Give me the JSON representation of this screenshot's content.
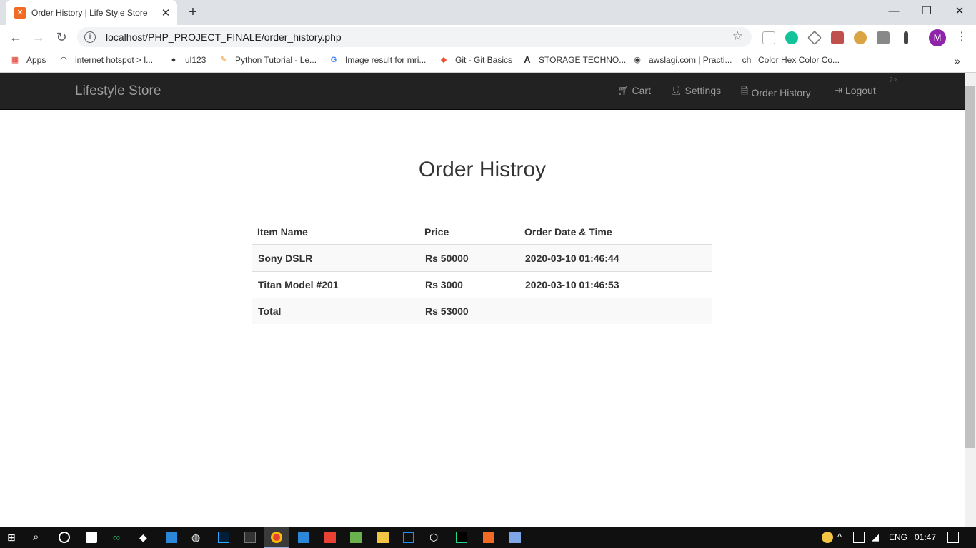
{
  "browser": {
    "tab_title": "Order History | Life Style Store",
    "url": "localhost/PHP_PROJECT_FINALE/order_history.php",
    "avatar_letter": "M",
    "bookmarks": [
      {
        "label": "Apps"
      },
      {
        "label": "internet hotspot > l..."
      },
      {
        "label": "ul123"
      },
      {
        "label": "Python Tutorial - Le..."
      },
      {
        "label": "Image result for mri..."
      },
      {
        "label": "Git - Git Basics"
      },
      {
        "label": "STORAGE TECHNO..."
      },
      {
        "label": "awslagi.com | Practi..."
      },
      {
        "label": "Color Hex Color Co..."
      }
    ]
  },
  "navbar": {
    "brand": "Lifestyle Store",
    "items": [
      {
        "label": "Cart",
        "icon": "cart-icon"
      },
      {
        "label": "Settings",
        "icon": "user-icon"
      },
      {
        "label": "Order History",
        "icon": "file-icon"
      },
      {
        "label": "Logout",
        "icon": "logout-icon"
      }
    ],
    "stray_text": "?>"
  },
  "page": {
    "heading": "Order Histroy"
  },
  "table": {
    "headers": [
      "Item Name",
      "Price",
      "Order Date & Time"
    ],
    "rows": [
      {
        "item": "Sony DSLR",
        "price": "Rs 50000",
        "date": "2020-03-10 01:46:44"
      },
      {
        "item": "Titan Model #201",
        "price": "Rs 3000",
        "date": "2020-03-10 01:46:53"
      }
    ],
    "total": {
      "label": "Total",
      "price": "Rs 53000"
    }
  },
  "taskbar": {
    "language": "ENG",
    "time": "01:47"
  },
  "colors": {
    "navbar_bg": "#222222",
    "navbar_text": "#9d9d9d",
    "avatar": "#8e24aa",
    "favicon": "#f26b24"
  }
}
